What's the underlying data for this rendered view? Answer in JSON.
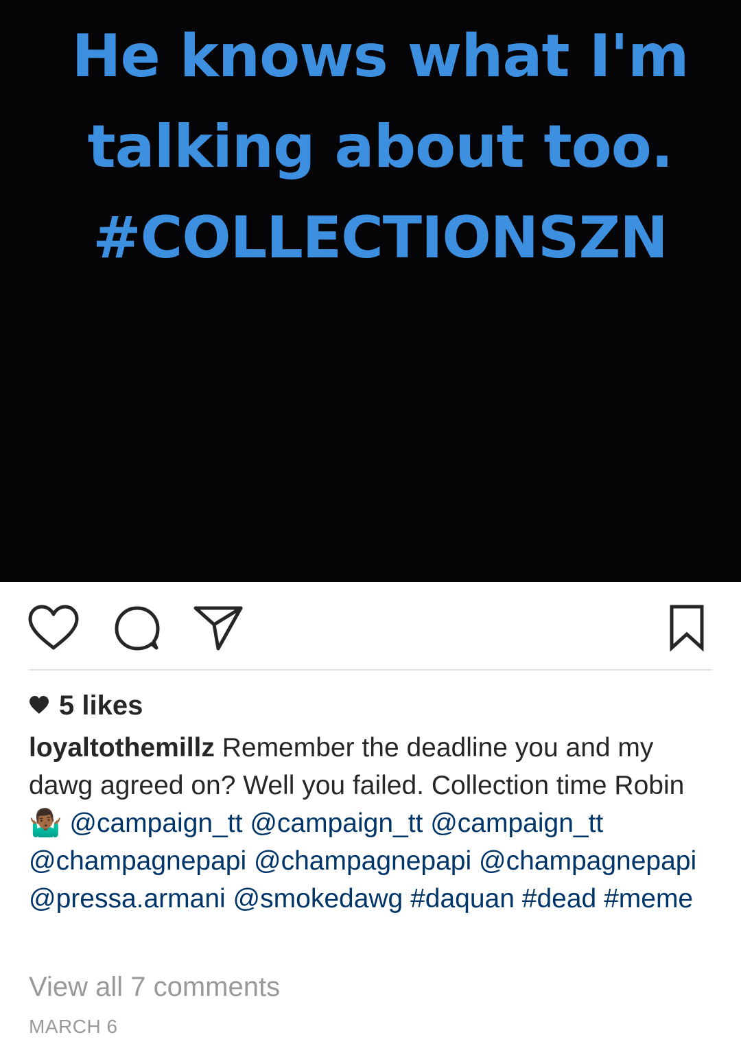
{
  "post": {
    "image_text": [
      "He knows what I'm",
      "talking about too.",
      "#COLLECTIONSZN"
    ]
  },
  "actions": {
    "like_icon": "heart-outline-icon",
    "comment_icon": "speech-bubble-icon",
    "share_icon": "paper-plane-icon",
    "save_icon": "bookmark-icon"
  },
  "likes": {
    "label": "5 likes"
  },
  "caption": {
    "username": "loyaltothemillz",
    "text_1": " Remember the deadline you and my dawg agreed on? Well you failed. Collection time Robin 🤷🏾‍♂️ ",
    "mentions": [
      "@campaign_tt",
      "@campaign_tt",
      "@campaign_tt",
      "@champagnepapi",
      "@champagnepapi",
      "@champagnepapi",
      "@pressa.armani",
      "@smokedawg"
    ],
    "hashtags": [
      "#daquan",
      "#dead",
      "#meme"
    ]
  },
  "comments": {
    "view_all_label": "View all 7 comments"
  },
  "date": "MARCH 6",
  "colors": {
    "image_text": "#3d8fe0",
    "link": "#003569",
    "muted": "#999999",
    "text": "#262626"
  }
}
